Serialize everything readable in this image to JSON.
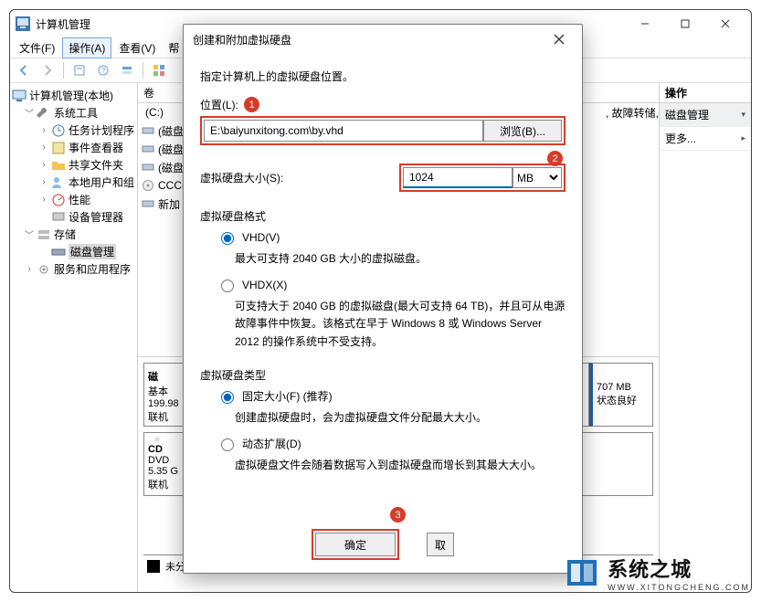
{
  "window": {
    "title": "计算机管理",
    "menu": {
      "file": "文件(F)",
      "action": "操作(A)",
      "view": "查看(V)",
      "help": "帮"
    }
  },
  "tree": {
    "root": "计算机管理(本地)",
    "systools": "系统工具",
    "tasksched": "任务计划程序",
    "eventviewer": "事件查看器",
    "sharedfolders": "共享文件夹",
    "localusers": "本地用户和组",
    "perf": "性能",
    "devmgr": "设备管理器",
    "storage": "存储",
    "diskmgmt": "磁盘管理",
    "services": "服务和应用程序"
  },
  "volumes": {
    "header": "卷",
    "rows": [
      "(C:)",
      "(磁盘",
      "(磁盘",
      "(磁盘",
      "CCC(",
      "新加"
    ]
  },
  "midrow": {
    "label": "磁",
    "type": "基本",
    "size": "199.98",
    "status": "联机",
    "part_size": "707 MB",
    "part_status": "状态良好"
  },
  "cdrow": {
    "label": "CD",
    "type": "DVD",
    "size": "5.35 G",
    "status": "联机"
  },
  "unalloc": "未分",
  "actions": {
    "header": "操作",
    "diskmgmt": "磁盘管理",
    "more": "更多...",
    "chev": "▸",
    "chev_down": "▾"
  },
  "toprow_tail": ", 故障转储, 基本",
  "dialog": {
    "title": "创建和附加虚拟硬盘",
    "intro": "指定计算机上的虚拟硬盘位置。",
    "loc_label": "位置(L):",
    "loc_value": "E:\\baiyunxitong.com\\by.vhd",
    "browse": "浏览(B)...",
    "size_label": "虚拟硬盘大小(S):",
    "size_value": "1024",
    "size_unit": "MB",
    "fmt_header": "虚拟硬盘格式",
    "vhd_label": "VHD(V)",
    "vhd_desc": "最大可支持 2040 GB 大小的虚拟磁盘。",
    "vhdx_label": "VHDX(X)",
    "vhdx_desc": "可支持大于 2040 GB 的虚拟磁盘(最大可支持 64 TB)，并且可从电源故障事件中恢复。该格式在早于 Windows 8 或 Windows Server 2012 的操作系统中不受支持。",
    "type_header": "虚拟硬盘类型",
    "fixed_label": "固定大小(F) (推荐)",
    "fixed_desc": "创建虚拟硬盘时，会为虚拟硬盘文件分配最大大小。",
    "dynamic_label": "动态扩展(D)",
    "dynamic_desc": "虚拟硬盘文件会随着数据写入到虚拟硬盘而增长到其最大大小。",
    "ok": "确定",
    "cancel": "取"
  },
  "callouts": {
    "c1": "1",
    "c2": "2",
    "c3": "3"
  },
  "watermark": {
    "big": "系统之城",
    "small": "WWW.XITONGCHENG.COM"
  }
}
